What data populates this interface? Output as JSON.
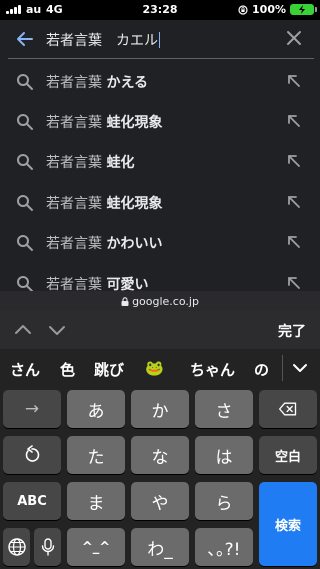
{
  "status_bar": {
    "carrier": "au",
    "network": "4G",
    "time": "23:28",
    "battery_percent": "100%",
    "battery_color": "#38d136"
  },
  "search": {
    "query": "若者言葉　カエル",
    "back_icon": "arrow-left-icon",
    "clear_icon": "close-icon",
    "accent_color": "#8ab4f8"
  },
  "suggestions": [
    {
      "prefix": "若者言葉",
      "completion": "かえる"
    },
    {
      "prefix": "若者言葉",
      "completion": "蛙化現象"
    },
    {
      "prefix": "若者言葉",
      "completion": "蛙化"
    },
    {
      "prefix": "若者言葉",
      "completion": "蛙化現象"
    },
    {
      "prefix": "若者言葉",
      "completion": "かわいい"
    },
    {
      "prefix": "若者言葉",
      "completion": "可愛い"
    }
  ],
  "url_bar": {
    "domain": "google.co.jp"
  },
  "accessory": {
    "done_label": "完了"
  },
  "candidates": [
    "さん",
    "色",
    "跳び",
    "🐸",
    "ちゃん",
    "の"
  ],
  "keys": {
    "row1": [
      "→",
      "あ",
      "か",
      "さ",
      "⌫"
    ],
    "row2": [
      "↺",
      "た",
      "な",
      "は",
      "空白"
    ],
    "row3": [
      "ABC",
      "ま",
      "や",
      "ら",
      "検索"
    ],
    "row4": [
      "🌐",
      "🎤",
      "^_^",
      "わ_",
      "､｡?!"
    ]
  }
}
